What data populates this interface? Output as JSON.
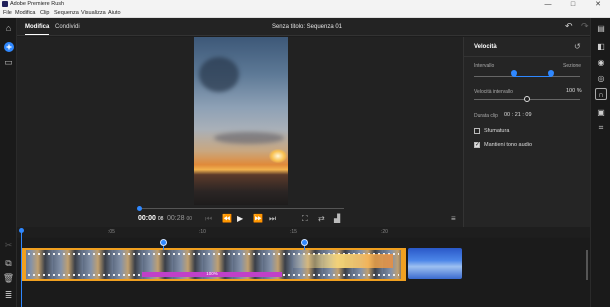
{
  "window": {
    "title": "Adobe Premiere Rush",
    "controls": [
      "—",
      "□",
      "✕"
    ]
  },
  "menubar": {
    "items": [
      "File",
      "Modifica",
      "Clip",
      "Sequenza",
      "Visualizza",
      "Aiuto"
    ]
  },
  "header": {
    "tabs": [
      {
        "label": "Modifica",
        "active": true
      },
      {
        "label": "Condividi",
        "active": false
      }
    ],
    "sequence_title": "Senza titolo: Sequenza 01"
  },
  "monitor": {
    "current_time": "00:00",
    "current_frames": "08",
    "total_time": "00:28",
    "total_frames": "00"
  },
  "panel": {
    "title": "Velocità",
    "interval_label": "Intervallo",
    "section_label": "Sezione",
    "interval_speed_label": "Velocità intervallo",
    "interval_speed_value": "100",
    "interval_speed_unit": "%",
    "clip_duration_label": "Durata clip",
    "clip_duration_value": "00 : 21 : 09",
    "fade_label": "Sfumatura",
    "fade_checked": false,
    "keep_pitch_label": "Mantieni tono audio",
    "keep_pitch_checked": true,
    "range_start_pct": 0.38,
    "range_end_pct": 0.73,
    "speed_slider_pct": 0.5
  },
  "timeline": {
    "ruler_labels": [
      ":05",
      ":10",
      ":15",
      ":20"
    ],
    "speed_label": "100%"
  },
  "colors": {
    "accent": "#2f88ff",
    "clip_border": "#f0a020",
    "speed_bar": "#c040c8"
  }
}
